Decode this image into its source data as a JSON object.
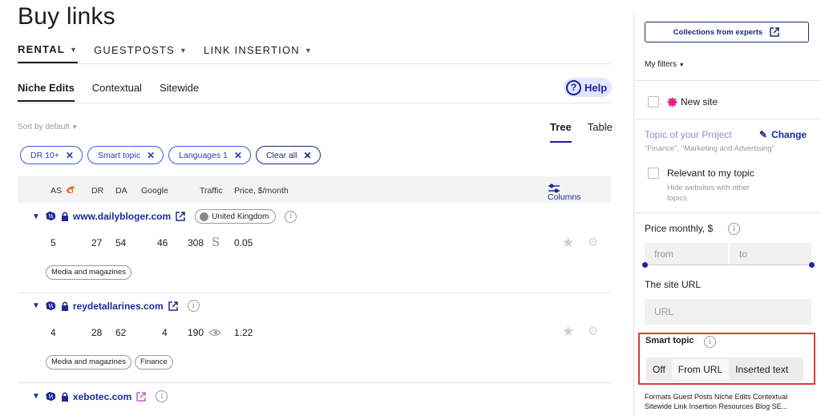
{
  "page_title": "Buy links",
  "top_nav": [
    {
      "label": "RENTAL",
      "active": true
    },
    {
      "label": "GUESTPOSTS",
      "active": false
    },
    {
      "label": "LINK INSERTION",
      "active": false
    }
  ],
  "sub_tabs": [
    {
      "label": "Niche Edits",
      "active": true
    },
    {
      "label": "Contextual",
      "active": false
    },
    {
      "label": "Sitewide",
      "active": false
    }
  ],
  "help_label": "Help",
  "help_icon": "?",
  "sort_label": "Sort by default",
  "view_tabs": [
    {
      "label": "Tree",
      "active": true
    },
    {
      "label": "Table",
      "active": false
    }
  ],
  "filter_chips": [
    "DR 10+",
    "Smart topic",
    "Languages 1"
  ],
  "clear_all_label": "Clear all",
  "chip_close_glyph": "✕",
  "table_headers": {
    "as": "AS",
    "dr": "DR",
    "da": "DA",
    "google": "Google",
    "traffic": "Traffic",
    "price": "Price, $/month",
    "columns": "Columns"
  },
  "rows": [
    {
      "domain": "www.dailybloger.com",
      "country": "United Kingdom",
      "as": "5",
      "dr": "27",
      "da": "54",
      "google": "46",
      "traffic": "308",
      "price": "0.05",
      "tags": [
        "Media and magazines"
      ]
    },
    {
      "domain": "reydetallarines.com",
      "as": "4",
      "dr": "28",
      "da": "62",
      "google": "4",
      "traffic": "190",
      "price": "1.22",
      "tags": [
        "Media and magazines",
        "Finance"
      ]
    },
    {
      "domain": "xebotec.com"
    }
  ],
  "sidebar": {
    "collections_label": "Collections from experts",
    "my_filters_label": "My filters",
    "new_site_label": "New site",
    "topic_title": "Topic of your Project",
    "change_label": "Change",
    "topic_examples": "\"Finance\", \"Marketing and Advertising\"",
    "relevant_label": "Relevant to my topic",
    "relevant_hint_line1": "Hide websites with other",
    "relevant_hint_line2": "topics",
    "price_label": "Price monthly, $",
    "price_from_placeholder": "from",
    "price_to_placeholder": "to",
    "site_url_label": "The site URL",
    "site_url_placeholder": "URL",
    "smart_topic_label": "Smart topic",
    "smart_topic_options": [
      "Off",
      "From URL",
      "Inserted text"
    ],
    "smart_topic_selected": "From URL",
    "formats_line1": "Formats Guest Posts Niche Edits Contextual",
    "formats_line2": "Sitewide Link Insertion Resources Blog SE..."
  },
  "colors": {
    "accent": "#1b2a9a",
    "chip_border": "#3c5bd6",
    "help_bg": "#dfe6ff",
    "highlight": "#e53935",
    "new_site_badge": "#e91e8c"
  }
}
